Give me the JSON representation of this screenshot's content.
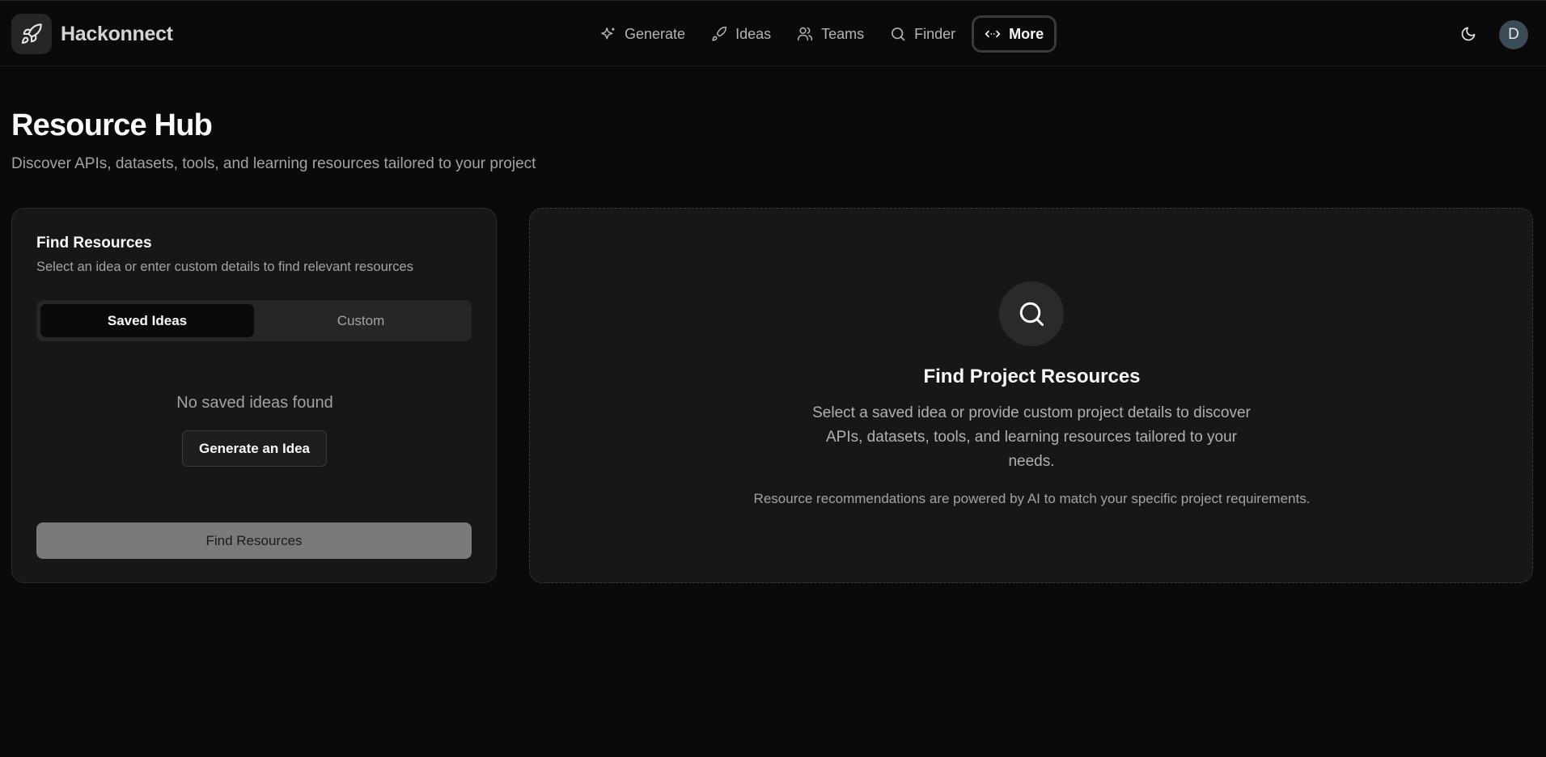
{
  "app": {
    "name": "Hackonnect",
    "avatar_initial": "D"
  },
  "nav": {
    "items": [
      {
        "label": "Generate",
        "icon": "sparkles-icon"
      },
      {
        "label": "Ideas",
        "icon": "rocket-icon"
      },
      {
        "label": "Teams",
        "icon": "users-icon"
      },
      {
        "label": "Finder",
        "icon": "search-icon"
      },
      {
        "label": "More",
        "icon": "code-arrows-icon",
        "active": true
      }
    ]
  },
  "page": {
    "title": "Resource Hub",
    "subtitle": "Discover APIs, datasets, tools, and learning resources tailored to your project"
  },
  "find_card": {
    "title": "Find Resources",
    "subtitle": "Select an idea or enter custom details to find relevant resources",
    "tabs": [
      {
        "label": "Saved Ideas",
        "active": true
      },
      {
        "label": "Custom",
        "active": false
      }
    ],
    "empty_text": "No saved ideas found",
    "generate_button": "Generate an Idea",
    "find_button": "Find Resources"
  },
  "info_panel": {
    "title": "Find Project Resources",
    "description": "Select a saved idea or provide custom project details to discover APIs, datasets, tools, and learning resources tailored to your needs.",
    "note": "Resource recommendations are powered by AI to match your specific project requirements."
  },
  "colors": {
    "background": "#0a0a0a",
    "card": "#171717",
    "border": "#2a2a2a",
    "muted_text": "#a3a3a3",
    "avatar": "#3b4c58"
  }
}
